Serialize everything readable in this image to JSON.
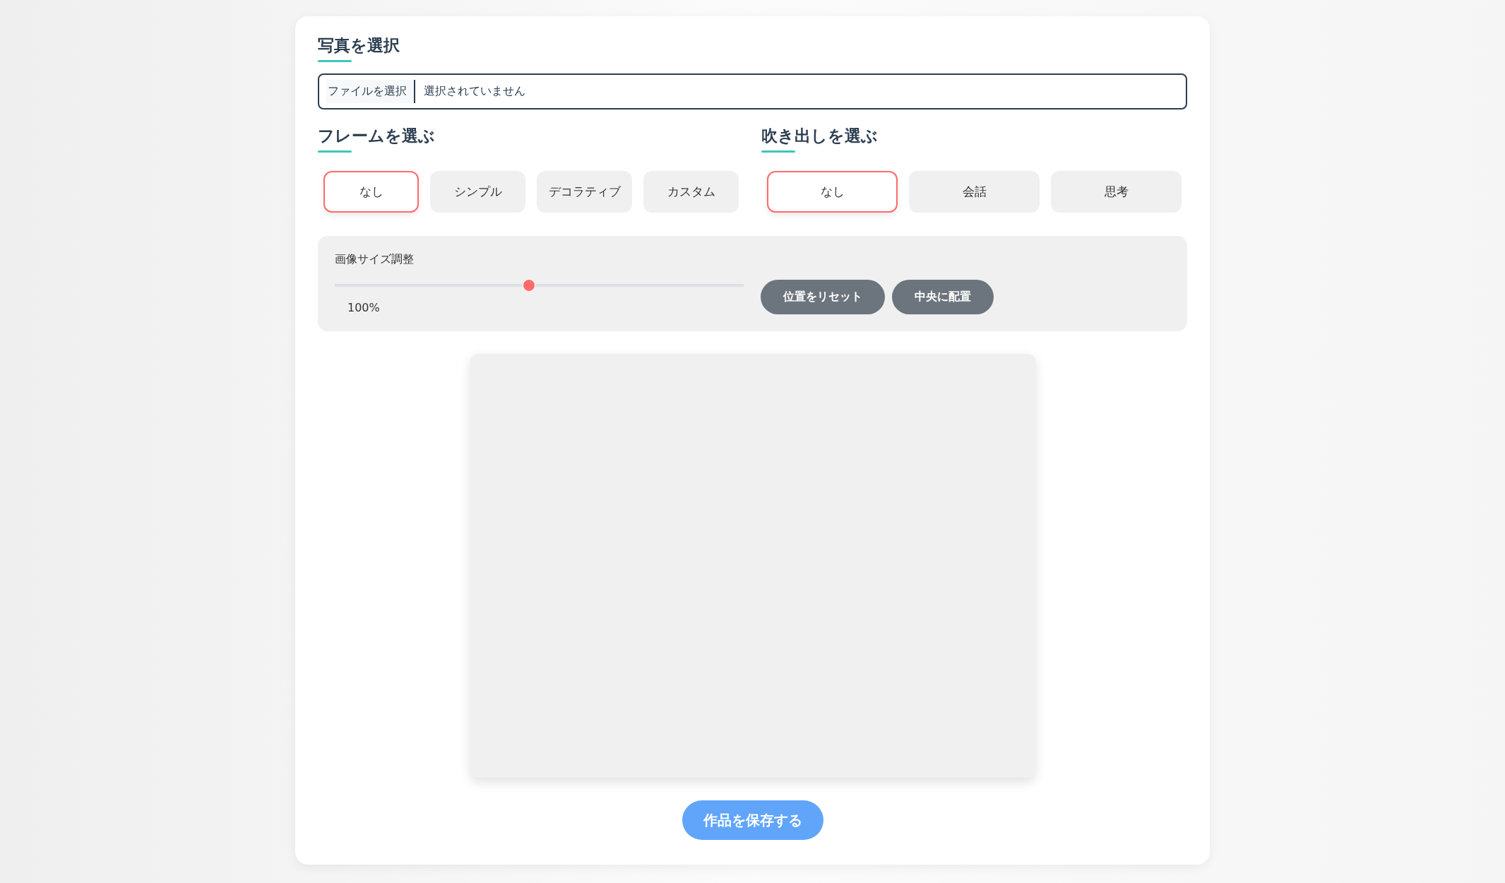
{
  "photo_section": {
    "title": "写真を選択",
    "file_button": "ファイルを選択",
    "file_status": "選択されていません"
  },
  "frame_section": {
    "title": "フレームを選ぶ",
    "options": [
      {
        "label": "なし",
        "selected": true
      },
      {
        "label": "シンプル",
        "selected": false
      },
      {
        "label": "デコラティブ",
        "selected": false
      },
      {
        "label": "カスタム",
        "selected": false
      }
    ]
  },
  "balloon_section": {
    "title": "吹き出しを選ぶ",
    "options": [
      {
        "label": "なし",
        "selected": true
      },
      {
        "label": "会話",
        "selected": false
      },
      {
        "label": "思考",
        "selected": false
      }
    ]
  },
  "size_control": {
    "label": "画像サイズ調整",
    "level": 0.475,
    "reading": "100%"
  },
  "position_buttons": [
    "位置をリセット",
    "中央に配置"
  ],
  "save_button": "作品を保存する"
}
